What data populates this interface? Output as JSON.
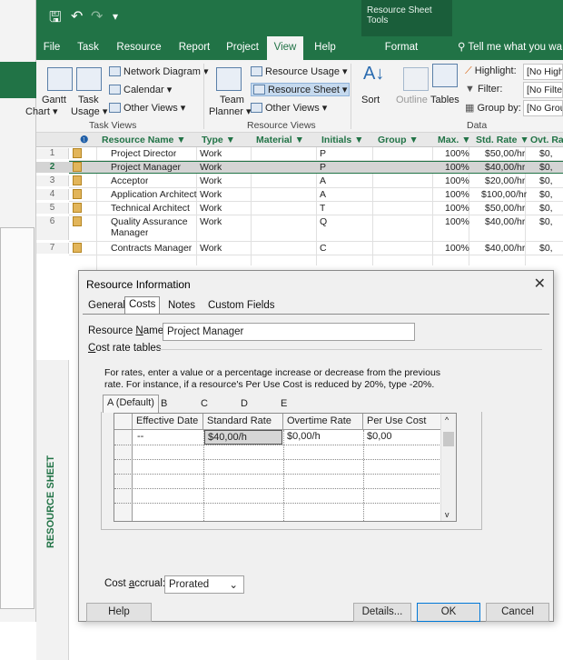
{
  "title_bar": {
    "context_title": "Resource Sheet Tools",
    "qat_save": "🖫",
    "qat_undo": "↶",
    "qat_redo": "↷",
    "qat_custom": "▾"
  },
  "tabs": [
    "File",
    "Task",
    "Resource",
    "Report",
    "Project",
    "View",
    "Help",
    "Format"
  ],
  "active_tab": "View",
  "tell_me": "Tell me what you wa",
  "ribbon": {
    "gantt": "Gantt",
    "gantt2": "Chart ▾",
    "task_usage": "Task",
    "task_usage2": "Usage ▾",
    "network_diagram": "Network Diagram ▾",
    "calendar": "Calendar ▾",
    "other_views_task": "Other Views ▾",
    "task_views_group": "Task Views",
    "team_planner": "Team",
    "team_planner2": "Planner ▾",
    "resource_usage": "Resource Usage ▾",
    "resource_sheet": "Resource Sheet ▾",
    "other_views_res": "Other Views ▾",
    "resource_views_group": "Resource Views",
    "sort": "Sort",
    "outline": "Outline",
    "tables": "Tables",
    "highlight_label": "Highlight:",
    "highlight_value": "[No High",
    "filter_label": "Filter:",
    "filter_value": "[No Filte",
    "groupby_label": "Group by:",
    "groupby_value": "[No Grou",
    "data_group": "Data"
  },
  "sheet": {
    "headers": [
      "Resource Name ▼",
      "Type ▼",
      "Material ▼",
      "Initials ▼",
      "Group ▼",
      "Max. ▼",
      "Std. Rate ▼",
      "Ovt. Ra"
    ],
    "rows": [
      {
        "num": "1",
        "name": "Project Director",
        "type": "Work",
        "initials": "P",
        "max": "100%",
        "rate": "$50,00/hr",
        "ovt": "$0,"
      },
      {
        "num": "2",
        "name": "Project Manager",
        "type": "Work",
        "initials": "P",
        "max": "100%",
        "rate": "$40,00/hr",
        "ovt": "$0,"
      },
      {
        "num": "3",
        "name": "Acceptor",
        "type": "Work",
        "initials": "A",
        "max": "100%",
        "rate": "$20,00/hr",
        "ovt": "$0,"
      },
      {
        "num": "4",
        "name": "Application Architect",
        "type": "Work",
        "initials": "A",
        "max": "100%",
        "rate": "$100,00/hr",
        "ovt": "$0,"
      },
      {
        "num": "5",
        "name": "Technical Architect",
        "type": "Work",
        "initials": "T",
        "max": "100%",
        "rate": "$50,00/hr",
        "ovt": "$0,"
      },
      {
        "num": "6",
        "name": "Quality Assurance",
        "name2": "Manager",
        "type": "Work",
        "initials": "Q",
        "max": "100%",
        "rate": "$40,00/hr",
        "ovt": "$0,"
      },
      {
        "num": "7",
        "name": "Contracts Manager",
        "type": "Work",
        "initials": "C",
        "max": "100%",
        "rate": "$40,00/hr",
        "ovt": "$0,"
      }
    ],
    "side_label": "RESOURCE SHEET"
  },
  "dialog": {
    "title": "Resource Information",
    "close": "✕",
    "tabs": [
      "General",
      "Costs",
      "Notes",
      "Custom Fields"
    ],
    "active_tab": "Costs",
    "resource_name_label_pre": "Resource ",
    "resource_name_label_u": "N",
    "resource_name_label_post": "ame:",
    "resource_name_value": "Project Manager",
    "cost_rate_tables_u": "C",
    "cost_rate_tables_post": "ost rate tables",
    "help_line1": "For rates, enter a value or a percentage increase or decrease from the previous",
    "help_line2": "rate. For instance, if a resource's Per Use Cost is reduced by 20%, type -20%.",
    "rate_tabs": [
      "A (Default)",
      "B",
      "C",
      "D",
      "E"
    ],
    "grid_headers": [
      "Effective Date",
      "Standard Rate",
      "Overtime Rate",
      "Per Use Cost"
    ],
    "grid_row": {
      "date": "--",
      "standard": "$40,00/h",
      "overtime": "$0,00/h",
      "per_use": "$0,00"
    },
    "accrual_label_pre": "Cost ",
    "accrual_label_u": "a",
    "accrual_label_post": "ccrual:",
    "accrual_value": "Prorated",
    "buttons": {
      "help": "Help",
      "details": "Details...",
      "ok": "OK",
      "cancel": "Cancel"
    }
  }
}
